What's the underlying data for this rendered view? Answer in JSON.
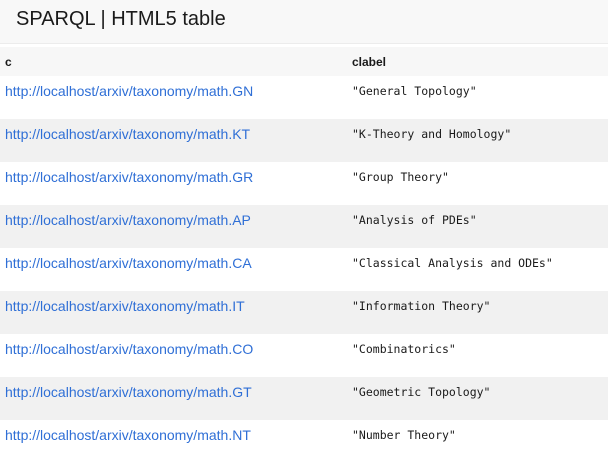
{
  "header": {
    "title": "SPARQL | HTML5 table"
  },
  "table": {
    "columns": [
      "c",
      "clabel"
    ],
    "rows": [
      {
        "c": "http://localhost/arxiv/taxonomy/math.GN",
        "clabel": "\"General Topology\""
      },
      {
        "c": "http://localhost/arxiv/taxonomy/math.KT",
        "clabel": "\"K-Theory and Homology\""
      },
      {
        "c": "http://localhost/arxiv/taxonomy/math.GR",
        "clabel": "\"Group Theory\""
      },
      {
        "c": "http://localhost/arxiv/taxonomy/math.AP",
        "clabel": "\"Analysis of PDEs\""
      },
      {
        "c": "http://localhost/arxiv/taxonomy/math.CA",
        "clabel": "\"Classical Analysis and ODEs\""
      },
      {
        "c": "http://localhost/arxiv/taxonomy/math.IT",
        "clabel": "\"Information Theory\""
      },
      {
        "c": "http://localhost/arxiv/taxonomy/math.CO",
        "clabel": "\"Combinatorics\""
      },
      {
        "c": "http://localhost/arxiv/taxonomy/math.GT",
        "clabel": "\"Geometric Topology\""
      },
      {
        "c": "http://localhost/arxiv/taxonomy/math.NT",
        "clabel": "\"Number Theory\""
      }
    ]
  },
  "colors": {
    "link": "#2f6fd6",
    "text": "#1a1a1a",
    "stripe": "#f1f1f1",
    "header_bg": "#f8f8f8"
  }
}
